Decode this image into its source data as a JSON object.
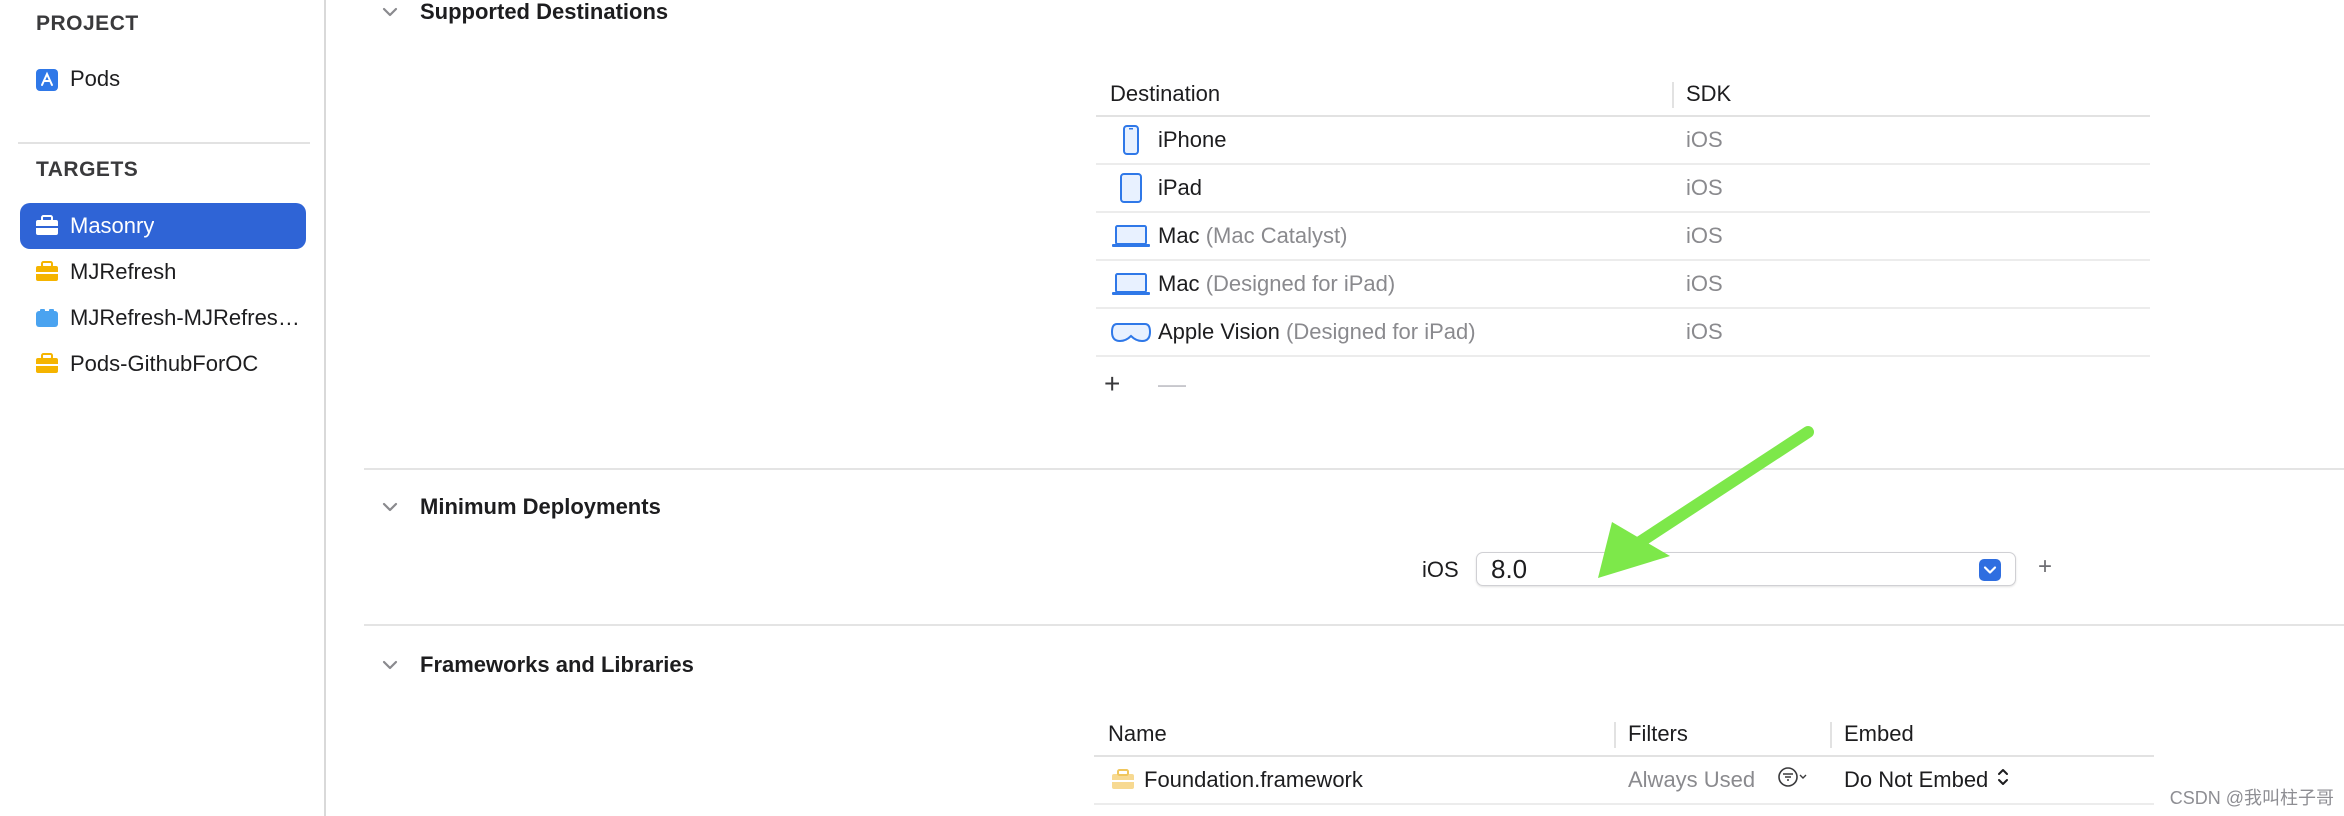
{
  "sidebar": {
    "project_header": "PROJECT",
    "project_item": "Pods",
    "targets_header": "TARGETS",
    "targets": [
      {
        "label": "Masonry",
        "icon": "toolbox-icon",
        "selected": true
      },
      {
        "label": "MJRefresh",
        "icon": "toolbox-icon",
        "selected": false
      },
      {
        "label": "MJRefresh-MJRefresh.Privacy",
        "icon": "bundle-icon",
        "selected": false
      },
      {
        "label": "Pods-GithubForOC",
        "icon": "toolbox-icon",
        "selected": false
      }
    ]
  },
  "sections": {
    "supported_destinations": {
      "title": "Supported Destinations",
      "columns": [
        "Destination",
        "SDK"
      ],
      "rows": [
        {
          "name": "iPhone",
          "detail": "",
          "sdk": "iOS",
          "icon": "iphone-icon"
        },
        {
          "name": "iPad",
          "detail": "",
          "sdk": "iOS",
          "icon": "ipad-icon"
        },
        {
          "name": "Mac",
          "detail": "(Mac Catalyst)",
          "sdk": "iOS",
          "icon": "laptop-icon"
        },
        {
          "name": "Mac",
          "detail": "(Designed for iPad)",
          "sdk": "iOS",
          "icon": "laptop-icon"
        },
        {
          "name": "Apple Vision",
          "detail": "(Designed for iPad)",
          "sdk": "iOS",
          "icon": "vision-pro-icon"
        }
      ],
      "add_label": "+",
      "remove_label": "—"
    },
    "minimum_deployments": {
      "title": "Minimum Deployments",
      "platform_label": "iOS",
      "value": "8.0",
      "add_label": "+"
    },
    "frameworks": {
      "title": "Frameworks and Libraries",
      "columns": [
        "Name",
        "Filters",
        "Embed"
      ],
      "rows": [
        {
          "name": "Foundation.framework",
          "filter": "Always Used",
          "embed": "Do Not Embed",
          "icon": "framework-icon"
        }
      ]
    }
  },
  "annotation": {
    "arrow_color": "#7de84a"
  },
  "watermark": "CSDN @我叫柱子哥",
  "colors": {
    "accent": "#2f64d6",
    "icon_blue": "#2f78e8",
    "icon_yellow": "#f5b400"
  }
}
